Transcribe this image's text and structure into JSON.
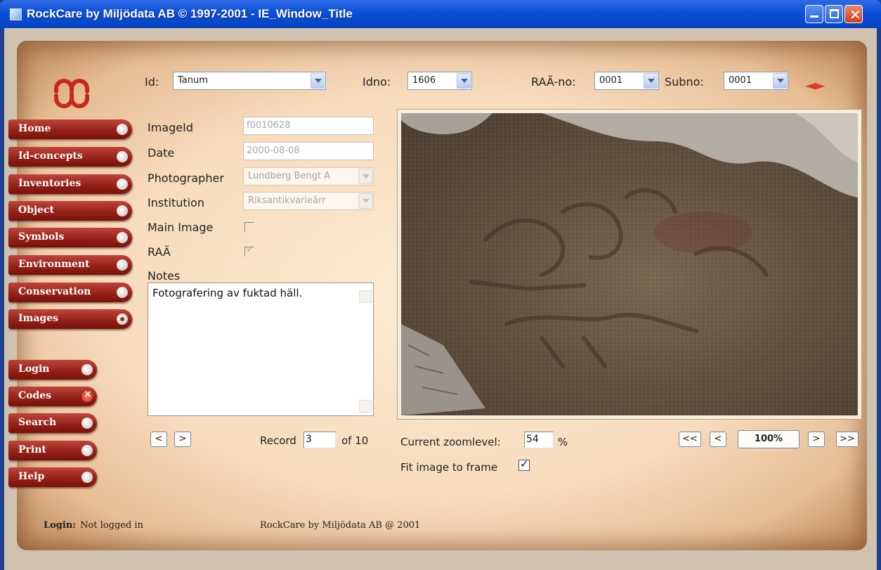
{
  "window": {
    "title": "RockCare by Miljödata AB © 1997-2001 - IE_Window_Title"
  },
  "header": {
    "id_label": "Id:",
    "id_value": "Tanum",
    "idno_label": "Idno:",
    "idno_value": "1606",
    "raa_label": "RAÄ-no:",
    "raa_value": "0001",
    "subno_label": "Subno:",
    "subno_value": "0001",
    "nav_arrows": "◄►"
  },
  "nav": {
    "main": [
      {
        "label": "Home"
      },
      {
        "label": "Id-concepts"
      },
      {
        "label": "Inventories"
      },
      {
        "label": "Object"
      },
      {
        "label": "Symbols"
      },
      {
        "label": "Environment"
      },
      {
        "label": "Conservation"
      },
      {
        "label": "Images"
      }
    ],
    "secondary": [
      {
        "label": "Login"
      },
      {
        "label": "Codes"
      },
      {
        "label": "Search"
      },
      {
        "label": "Print"
      },
      {
        "label": "Help"
      }
    ]
  },
  "form": {
    "imageid_label": "ImageId",
    "imageid_value": "f0010628",
    "date_label": "Date",
    "date_value": "2000-08-08",
    "photographer_label": "Photographer",
    "photographer_value": "Lundberg Bengt A",
    "institution_label": "Institution",
    "institution_value": "Riksantikvarieärr",
    "main_image_label": "Main Image",
    "main_image_checked": false,
    "raa_label": "RAÄ",
    "raa_checked": true,
    "notes_label": "Notes",
    "notes_value": "Fotografering av fuktad häll."
  },
  "record": {
    "prev": "<",
    "next": ">",
    "label": "Record",
    "current": "3",
    "of_text": "of 10"
  },
  "zoom": {
    "label": "Current zoomlevel:",
    "value": "54",
    "unit": "%",
    "first": "<<",
    "prev": "<",
    "reset": "100%",
    "next": ">",
    "last": ">>",
    "fit_label": "Fit image to frame",
    "fit_checked": true
  },
  "footer": {
    "login_label": "Login:",
    "login_status": "Not logged in",
    "copyright": "RockCare by Miljödata AB @ 2001"
  },
  "colors": {
    "nav_button": "#952118",
    "parchment": "#f7dcbd",
    "titlebar": "#0a4fd6",
    "nav_arrows": "#d6402a"
  }
}
